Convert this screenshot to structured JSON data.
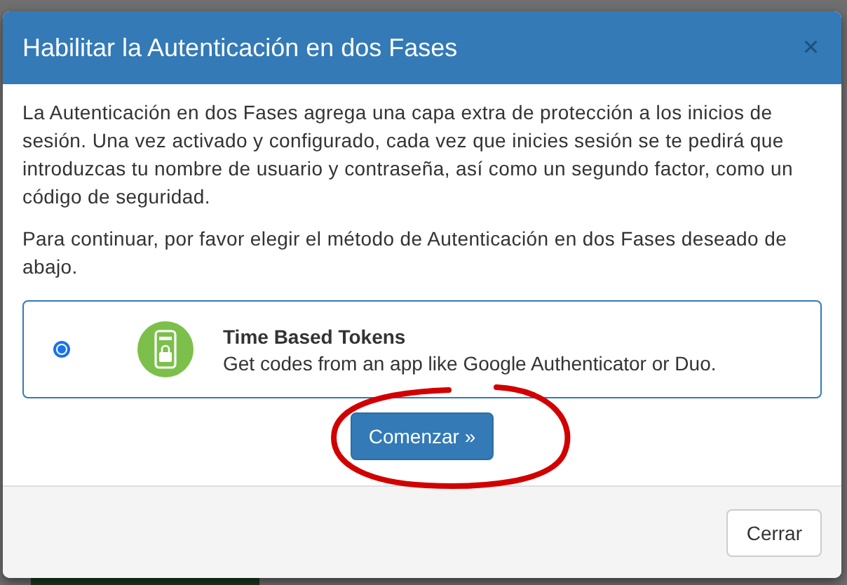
{
  "dialog": {
    "title": "Habilitar la Autenticación en dos Fases",
    "close_symbol": "×",
    "paragraphs": [
      "La Autenticación en dos Fases agrega una capa extra de protección a los inicios de sesión. Una vez activado y configurado, cada vez que inicies sesión se te pedirá que introduzcas tu nombre de usuario y contraseña, así como un segundo factor, como un código de seguridad.",
      "Para continuar, por favor elegir el método de Autenticación en dos Fases deseado de abajo."
    ],
    "methods": [
      {
        "title": "Time Based Tokens",
        "description": "Get codes from an app like Google Authenticator or Duo.",
        "selected": true
      }
    ],
    "start_button": "Comenzar »",
    "close_button": "Cerrar"
  }
}
